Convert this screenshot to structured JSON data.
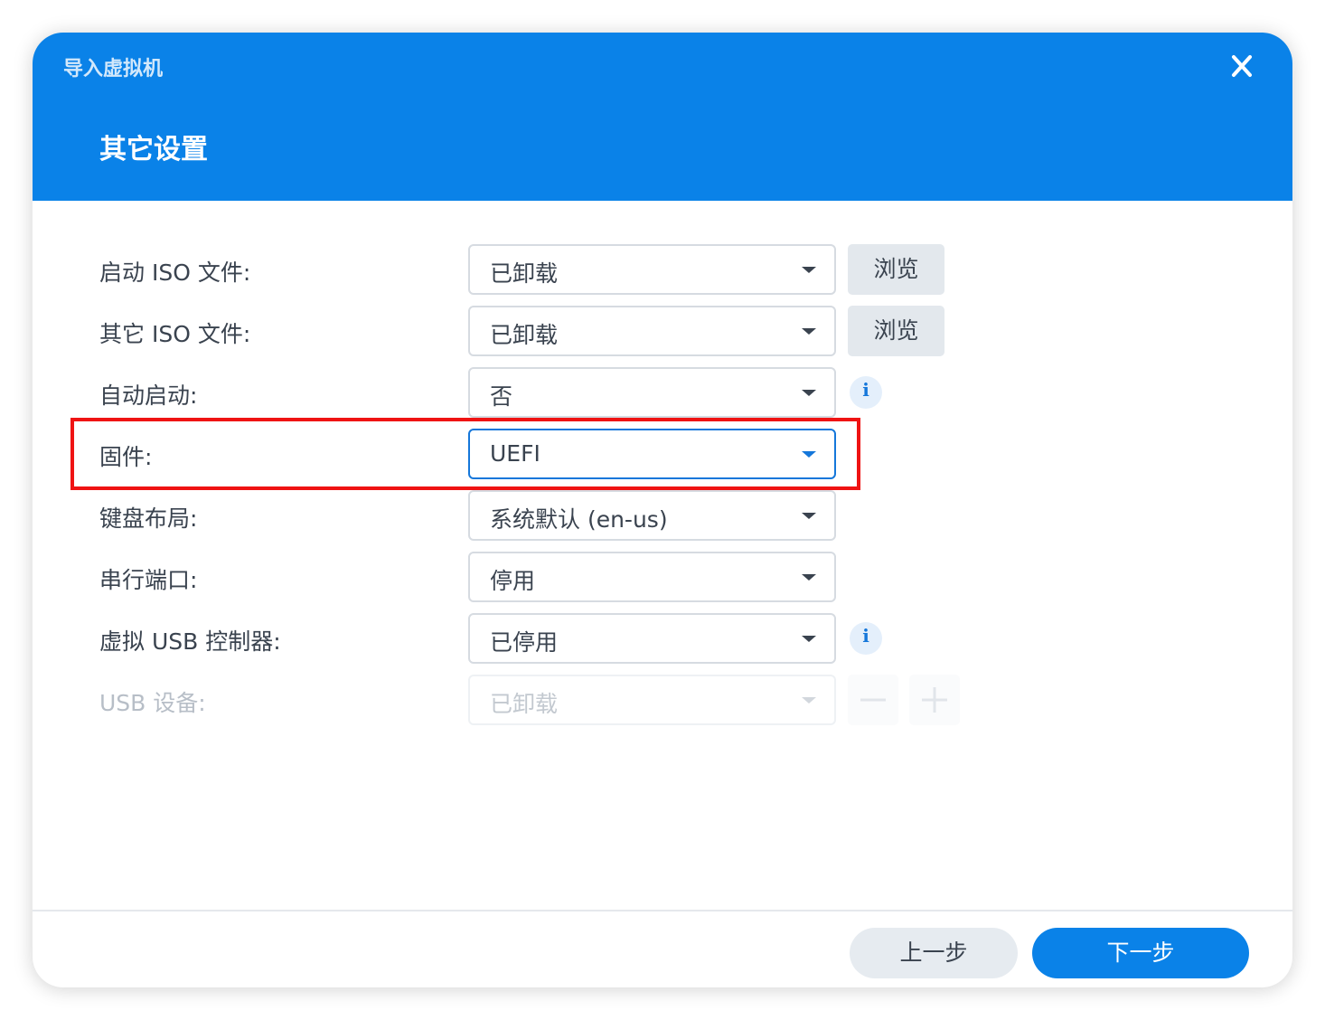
{
  "window": {
    "title": "导入虚拟机",
    "close_icon": "close-icon"
  },
  "header": {
    "section_title": "其它设置"
  },
  "form": {
    "rows": [
      {
        "label": "启动 ISO 文件:",
        "value": "已卸载",
        "button": "浏览"
      },
      {
        "label": "其它 ISO 文件:",
        "value": "已卸载",
        "button": "浏览"
      },
      {
        "label": "自动启动:",
        "value": "否",
        "info_icon": "info-icon"
      },
      {
        "label": "固件:",
        "value": "UEFI",
        "state": "focused",
        "highlighted": true
      },
      {
        "label": "键盘布局:",
        "value": "系统默认 (en-us)"
      },
      {
        "label": "串行端口:",
        "value": "停用"
      },
      {
        "label": "虚拟 USB 控制器:",
        "value": "已停用",
        "info_icon": "info-icon"
      },
      {
        "label": "USB 设备:",
        "value": "已卸载",
        "state": "disabled",
        "remove_icon": "minus-icon",
        "add_icon": "plus-icon"
      }
    ]
  },
  "footer": {
    "prev_label": "上一步",
    "next_label": "下一步"
  },
  "colors": {
    "header_bg": "#0a82e8",
    "accent": "#1577da",
    "highlight_border": "#ef1313",
    "primary_button": "#0a82e8",
    "secondary_button": "#e6ebf0"
  }
}
